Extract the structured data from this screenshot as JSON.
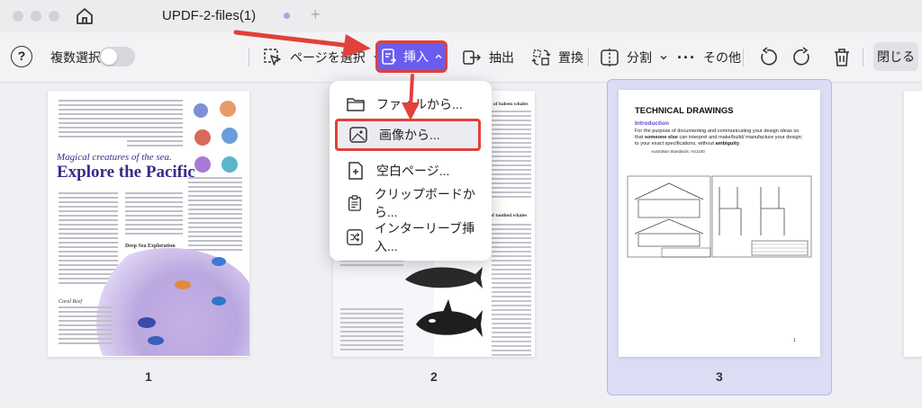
{
  "window": {
    "title": "UPDF-2-files(1)"
  },
  "toolbar": {
    "multi_select_label": "複数選択",
    "select_page_label": "ページを選択",
    "insert_label": "挿入",
    "extract_label": "抽出",
    "replace_label": "置換",
    "split_label": "分割",
    "more_label": "その他",
    "close_label": "閉じる"
  },
  "insert_menu": {
    "items": [
      {
        "label": "ファイルから...",
        "icon": "folder-icon"
      },
      {
        "label": "画像から...",
        "icon": "image-icon"
      },
      {
        "label": "空白ページ...",
        "icon": "blank-page-icon"
      },
      {
        "label": "クリップボードから...",
        "icon": "clipboard-icon"
      },
      {
        "label": "インターリーブ挿入...",
        "icon": "interleave-icon"
      }
    ],
    "highlighted_index": 1
  },
  "pages": [
    {
      "number": "1",
      "heading_script": "Magical creatures of the sea.",
      "heading": "Explore the Pacific",
      "subhead_1": "Deep Sea Exploration",
      "subhead_2": "Coral Reef"
    },
    {
      "number": "2",
      "heading_1": "of baleen whales",
      "heading_2": "d of toothed whales"
    },
    {
      "number": "3",
      "title": "TECHNICAL DRAWINGS",
      "subtitle": "Introduction",
      "body_1": "For the purpose of documenting and communicating your design ideas so that ",
      "body_bold_1": "someone else",
      "body_2": " can interpret and make/build/ manufacture your design; to your exact specifications, without ",
      "body_bold_2": "ambiguity",
      "body_3": ".",
      "standards": "Australian Standards:   AS1100",
      "footer_number": "1",
      "selected": true
    }
  ],
  "colors": {
    "accent": "#6b5cf0",
    "highlight_border": "#e2403a",
    "selected_page_bg": "#dcdcf5"
  }
}
